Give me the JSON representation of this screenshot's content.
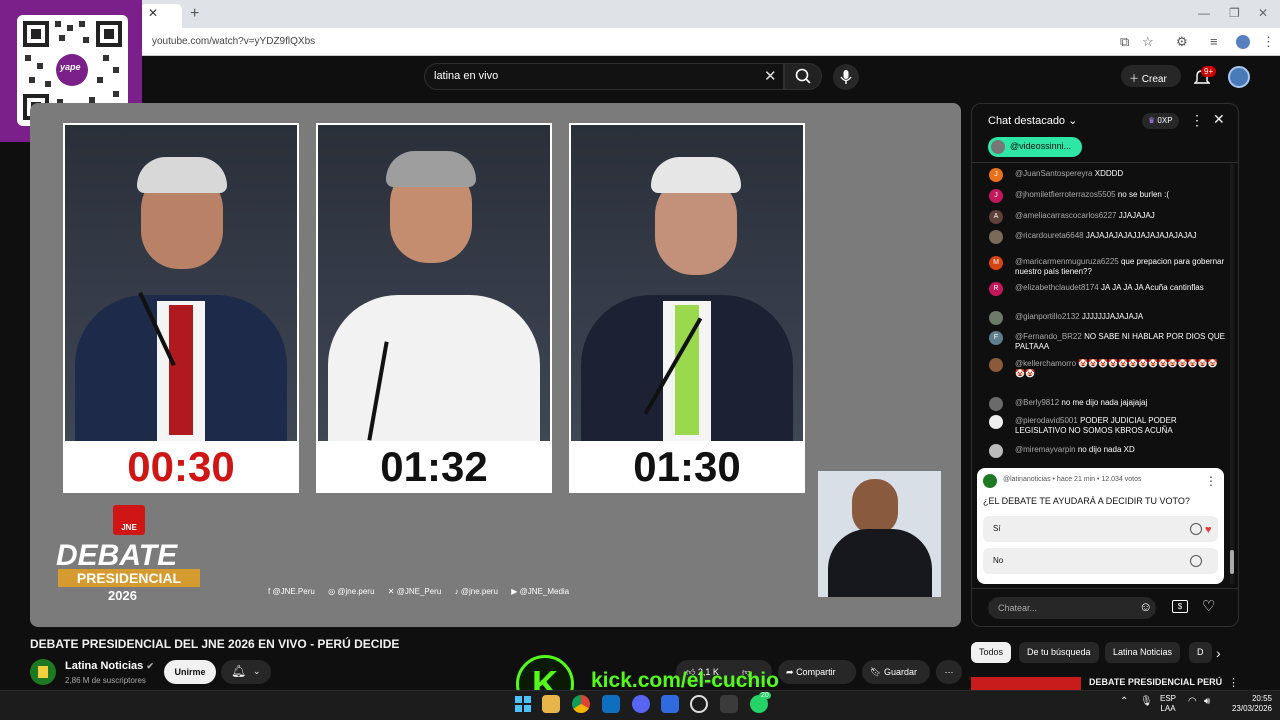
{
  "browser": {
    "url": "youtube.com/watch?v=yYDZ9flQXbs"
  },
  "overlay": {
    "qr_brand": "yape",
    "kick_letter": "K",
    "kick_text": "kick.com/el-cuchio"
  },
  "header": {
    "search_value": "latina en vivo",
    "create_label": "Crear",
    "notification_count": "9+"
  },
  "video": {
    "timers": [
      "00:30",
      "01:32",
      "01:30"
    ],
    "logo_top": "JNE",
    "logo_debate": "DEBATE",
    "logo_presidencial": "PRESIDENCIAL",
    "logo_year": "2026",
    "socials": [
      "@JNE.Peru",
      "@jne.peru",
      "@JNE_Peru",
      "@jne.peru",
      "@JNE_Media"
    ]
  },
  "chat": {
    "title": "Chat destacado",
    "points": "0XP",
    "pinned_user": "@videossinni...",
    "messages": [
      {
        "author": "@JuanSantospereyra",
        "text": "XDDDD",
        "initial": "J",
        "color": "#e8711c"
      },
      {
        "author": "@jhomiletfierroterrazos5505",
        "text": "no se burlen :(",
        "initial": "J",
        "color": "#c2185b"
      },
      {
        "author": "@ameliacarrascocarlos6227",
        "text": "JJAJAJAJ",
        "initial": "A",
        "color": "#5d4037"
      },
      {
        "author": "@ricardoureta6648",
        "text": "JAJAJAJAJAJJAJAJAJAJAJAJ",
        "initial": "",
        "color": "#7a6a5a"
      },
      {
        "author": "@maricarmenmuguruza6225",
        "text": "que prepacion para gobernar nuestro país tienen??",
        "initial": "M",
        "color": "#d84315"
      },
      {
        "author": "@elizabethclaudet8174",
        "text": "JA JA JA JA Acuña cantinflas",
        "initial": "R",
        "color": "#c2185b"
      },
      {
        "author": "@gianportillo2132",
        "text": "JJJJJJJAJAJAJA",
        "initial": "",
        "color": "#6d7a6a"
      },
      {
        "author": "@Fernando_BR22",
        "text": "NO SABE NI HABLAR POR DIOS QUE PALTAAA",
        "initial": "F",
        "color": "#607d8b"
      },
      {
        "author": "@kellerchamorro",
        "text": "🤡🤡🤡🤡🤡🤡🤡🤡🤡🤡🤡🤡🤡🤡🤡🤡",
        "initial": "",
        "color": "#8a5a3a"
      },
      {
        "author": "@Berly9812",
        "text": "no me dijo nada jajajajaj",
        "initial": "",
        "color": "#6a6a6a"
      },
      {
        "author": "@pierodavid5001",
        "text": "PODER JUDICIAL PODER LEGISLATIVO NO SOMOS KBROS ACUÑA",
        "initial": "",
        "color": "#eeeeee"
      },
      {
        "author": "@miremayvarpin",
        "text": "no dijo nada XD",
        "initial": "",
        "color": "#bbbbbb"
      }
    ],
    "poll": {
      "author": "@latinanoticias",
      "meta": "• hace 21 min • 12.034 votos",
      "question": "¿EL DEBATE TE AYUDARÁ A DECIDIR TU VOTO?",
      "options": [
        "Sí",
        "No"
      ]
    },
    "input_placeholder": "Chatear..."
  },
  "below": {
    "title": "DEBATE PRESIDENCIAL DEL JNE 2026 EN VIVO - PERÚ DECIDE",
    "channel": "Latina Noticias",
    "subscribers": "2,86 M de suscriptores",
    "join_label": "Unirme",
    "likes": "2,1 K",
    "share_label": "Compartir",
    "save_label": "Guardar",
    "filters": [
      "Todos",
      "De tu búsqueda",
      "Latina Noticias",
      "D"
    ],
    "related_title": "DEBATE PRESIDENCIAL PERÚ"
  },
  "taskbar": {
    "lang_top": "ESP",
    "lang_bottom": "LAA",
    "time": "20:55",
    "date": "23/03/2026",
    "whatsapp_badge": "20"
  }
}
